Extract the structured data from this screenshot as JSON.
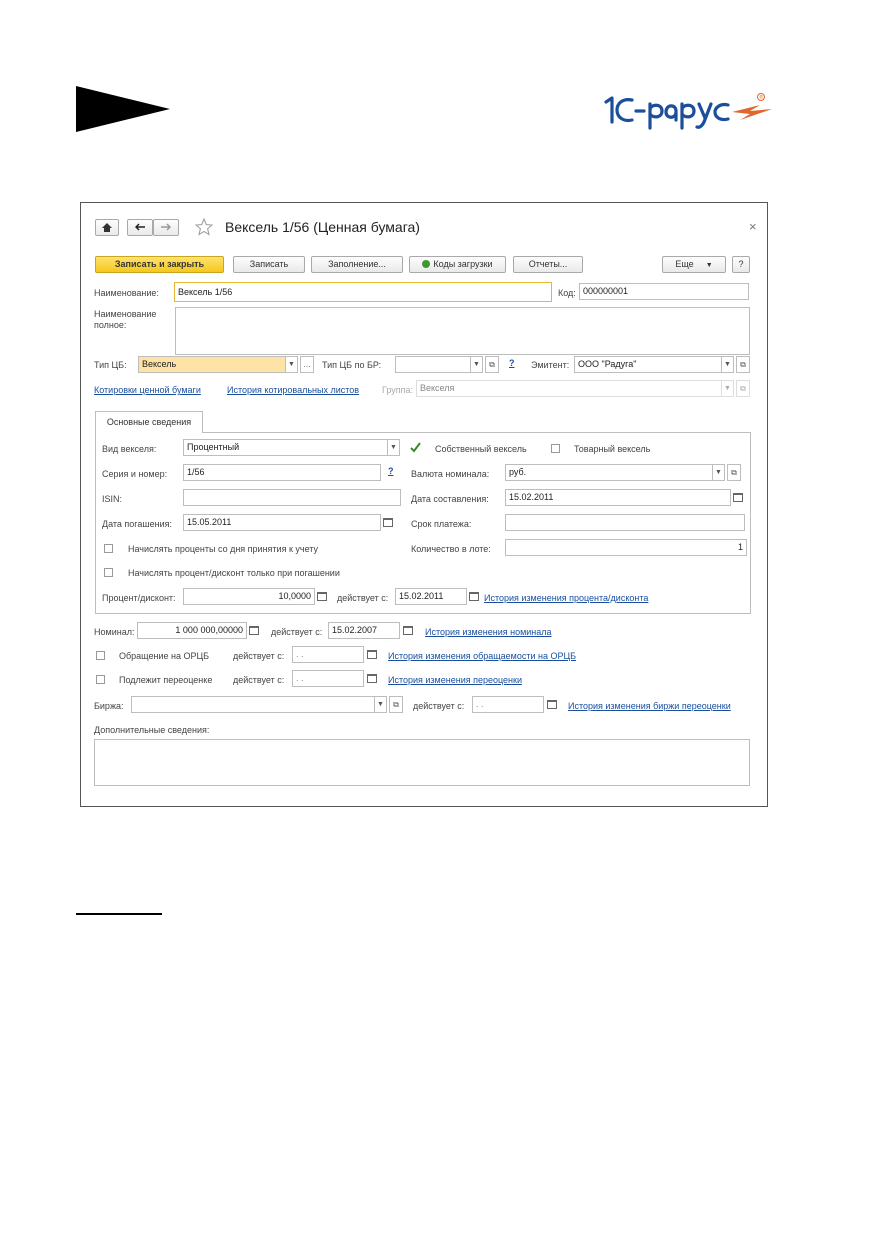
{
  "logo": {
    "brand_text": "1С-рарус",
    "registered": "®"
  },
  "window": {
    "title": "Вексель 1/56 (Ценная бумага)",
    "close": "×"
  },
  "toolbar": {
    "save_close": "Записать и закрыть",
    "save": "Записать",
    "fill": "Заполнение...",
    "codes": "Коды загрузки",
    "reports": "Отчеты...",
    "more": "Еще",
    "help": "?"
  },
  "header": {
    "name_label": "Наименование:",
    "name_value": "Вексель 1/56",
    "code_label": "Код:",
    "code_value": "000000001",
    "full_name_label_1": "Наименование",
    "full_name_label_2": "полное:",
    "full_name_value": "",
    "type_label": "Тип ЦБ:",
    "type_value": "Вексель",
    "type_br_label": "Тип ЦБ по БР:",
    "type_br_value": "",
    "issuer_label": "Эмитент:",
    "issuer_value": "ООО \"Радуга\"",
    "quotes_link": "Котировки ценной бумаги",
    "history_link": "История котировальных листов",
    "group_label": "Группа:",
    "group_value": "Векселя"
  },
  "tabs": [
    {
      "label": "Основные сведения"
    }
  ],
  "main": {
    "bill_type_label": "Вид векселя:",
    "bill_type_value": "Процентный",
    "own_bill_label": "Собственный вексель",
    "own_bill_checked": true,
    "commodity_bill_label": "Товарный вексель",
    "commodity_bill_checked": false,
    "series_label": "Серия и номер:",
    "series_value": "1/56",
    "currency_label": "Валюта номинала:",
    "currency_value": "руб.",
    "isin_label": "ISIN:",
    "isin_value": "",
    "issue_date_label": "Дата составления:",
    "issue_date_value": "15.02.2011",
    "maturity_label": "Дата погашения:",
    "maturity_value": "15.05.2011",
    "term_label": "Срок платежа:",
    "term_value": "",
    "accrue_label": "Начислять проценты со дня принятия к учету",
    "lot_label": "Количество в лоте:",
    "lot_value": "1",
    "accrue_maturity_label": "Начислять процент/дисконт только при погашении",
    "percent_label": "Процент/дисконт:",
    "percent_value": "10,0000",
    "percent_from_label": "действует с:",
    "percent_from_value": "15.02.2011",
    "percent_history_link": "История изменения процента/дисконта"
  },
  "bottom": {
    "nominal_label": "Номинал:",
    "nominal_value": "1 000 000,00000",
    "nominal_from_label": "действует с:",
    "nominal_from_value": "15.02.2007",
    "nominal_history_link": "История изменения номинала",
    "orcb_label": "Обращение на ОРЦБ",
    "orcb_from_label": "действует с:",
    "orcb_from_value": " .  .",
    "orcb_history_link": "История изменения обращаемости на ОРЦБ",
    "reval_label": "Подлежит переоценке",
    "reval_from_label": "действует с:",
    "reval_from_value": " .  .",
    "reval_history_link": "История изменения переоценки",
    "exchange_label": "Биржа:",
    "exchange_value": "",
    "exchange_from_label": "действует с:",
    "exchange_from_value": " .  .",
    "exchange_history_link": "История изменения биржи переоценки",
    "extra_label": "Дополнительные сведения:",
    "extra_value": ""
  }
}
